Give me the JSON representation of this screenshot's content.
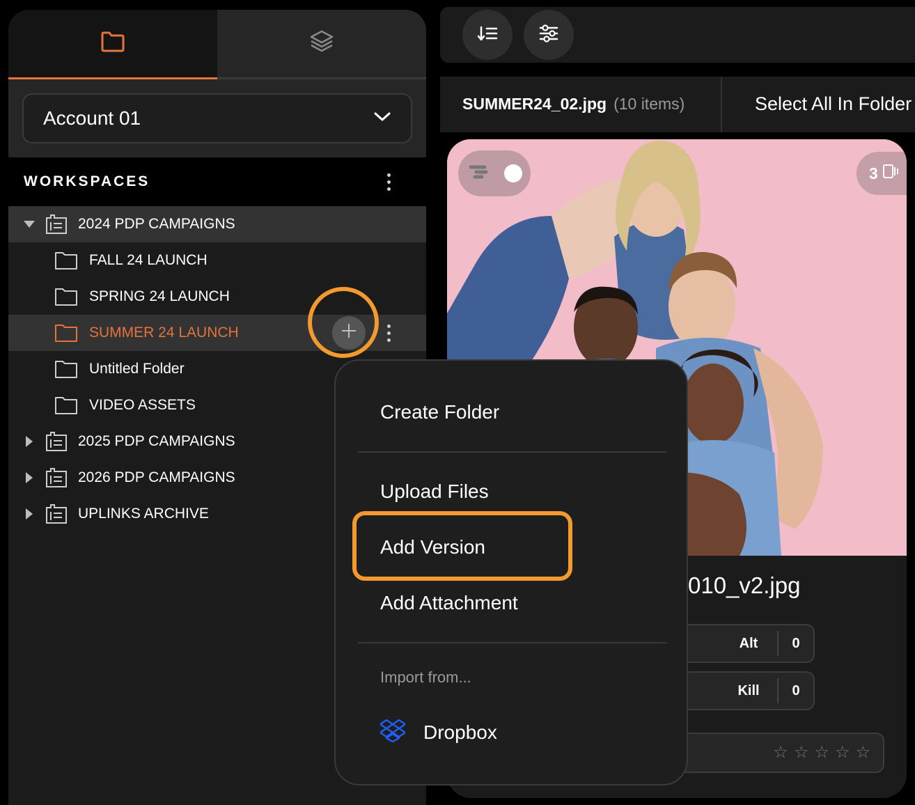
{
  "sidebar": {
    "tabs": [
      {
        "icon": "folder-icon",
        "active": true
      },
      {
        "icon": "layers-icon",
        "active": false
      }
    ],
    "account": {
      "value": "Account 01"
    },
    "workspaces_label": "WORKSPACES",
    "tree": [
      {
        "label": "2024 PDP CAMPAIGNS",
        "level": 0,
        "expanded": true,
        "selected": true
      },
      {
        "label": "FALL 24 LAUNCH",
        "level": 1
      },
      {
        "label": "SPRING 24 LAUNCH",
        "level": 1
      },
      {
        "label": "SUMMER 24 LAUNCH",
        "level": 1,
        "highlighted": true
      },
      {
        "label": "Untitled Folder",
        "level": 1
      },
      {
        "label": "VIDEO ASSETS",
        "level": 1
      },
      {
        "label": "2025 PDP CAMPAIGNS",
        "level": 0,
        "expanded": false
      },
      {
        "label": "2026 PDP CAMPAIGNS",
        "level": 0,
        "expanded": false
      },
      {
        "label": "UPLINKS ARCHIVE",
        "level": 0,
        "expanded": false
      }
    ]
  },
  "toolbar": {
    "buttons": [
      {
        "icon": "sort-icon"
      },
      {
        "icon": "filter-sliders-icon"
      }
    ]
  },
  "breadcrumb": {
    "file": "SUMMER24_02.jpg",
    "count": "(10 items)",
    "select_all": "Select All In Folder"
  },
  "card": {
    "version_count": "3",
    "file_name": "010_v2.jpg",
    "counters": [
      {
        "label": "Alt",
        "value": "0"
      },
      {
        "label": "Kill",
        "value": "0"
      }
    ],
    "rating": 0,
    "star_glyph": "☆"
  },
  "menu": {
    "items": [
      "Create Folder",
      "Upload Files",
      "Add Version",
      "Add Attachment"
    ],
    "import_label": "Import from...",
    "dropbox_label": "Dropbox"
  },
  "colors": {
    "accent": "#e4733c",
    "highlight_ring": "#f29a2e",
    "photo_bg": "#f2bcc8",
    "dropbox_blue": "#1f5ff5"
  }
}
